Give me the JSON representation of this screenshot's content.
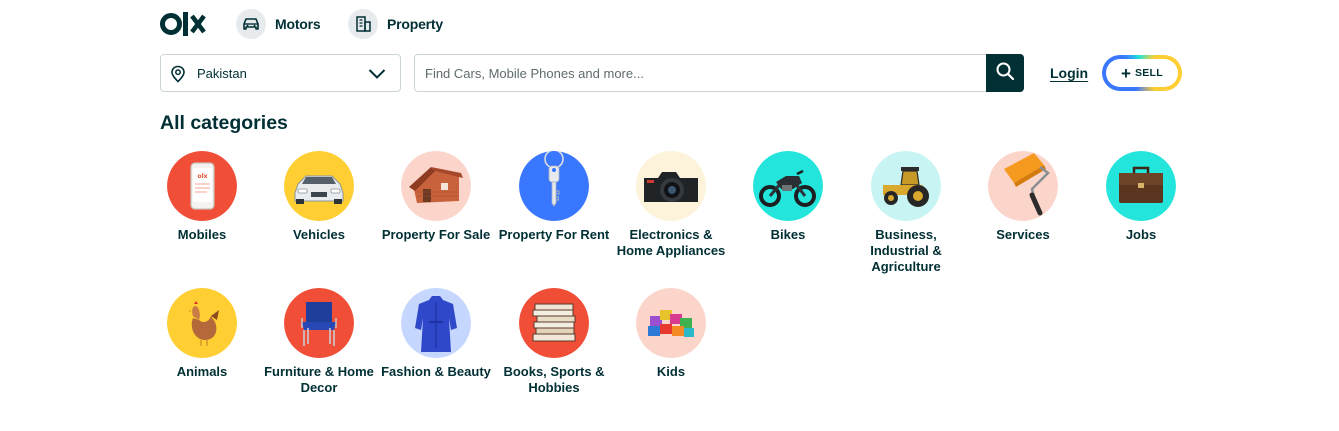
{
  "header": {
    "logo_text": "olx",
    "nav": [
      {
        "label": "Motors",
        "icon": "car-icon"
      },
      {
        "label": "Property",
        "icon": "building-icon"
      }
    ]
  },
  "location": {
    "value": "Pakistan",
    "icon": "location-pin-icon"
  },
  "search": {
    "placeholder": "Find Cars, Mobile Phones and more...",
    "value": "",
    "icon": "search-icon"
  },
  "login_label": "Login",
  "sell": {
    "label": "SELL",
    "plus": "+"
  },
  "heading": "All categories",
  "colors": {
    "primary": "#002f34",
    "border": "#ccd5d6"
  },
  "categories": [
    {
      "label": "Mobiles",
      "icon": "mobile-phone-icon",
      "bg": "#f04e37"
    },
    {
      "label": "Vehicles",
      "icon": "car-icon",
      "bg": "#ffce32"
    },
    {
      "label": "Property For Sale",
      "icon": "house-icon",
      "bg": "#fbd5ca"
    },
    {
      "label": "Property For Rent",
      "icon": "key-icon",
      "bg": "#3a77ff"
    },
    {
      "label": "Electronics & Home Appliances",
      "icon": "camera-icon",
      "bg": "#fdf3da"
    },
    {
      "label": "Bikes",
      "icon": "motorbike-icon",
      "bg": "#23e5db"
    },
    {
      "label": "Business, Industrial & Agriculture",
      "icon": "tractor-icon",
      "bg": "#c8f5f4"
    },
    {
      "label": "Services",
      "icon": "paint-roller-icon",
      "bg": "#fbd5ca"
    },
    {
      "label": "Jobs",
      "icon": "briefcase-icon",
      "bg": "#23e5db"
    },
    {
      "label": "Animals",
      "icon": "hen-icon",
      "bg": "#ffce32"
    },
    {
      "label": "Furniture & Home Decor",
      "icon": "chair-icon",
      "bg": "#f04e37"
    },
    {
      "label": "Fashion & Beauty",
      "icon": "dress-icon",
      "bg": "#c5d6ff"
    },
    {
      "label": "Books, Sports & Hobbies",
      "icon": "books-icon",
      "bg": "#f04e37"
    },
    {
      "label": "Kids",
      "icon": "toy-blocks-icon",
      "bg": "#fbd5ca"
    }
  ]
}
